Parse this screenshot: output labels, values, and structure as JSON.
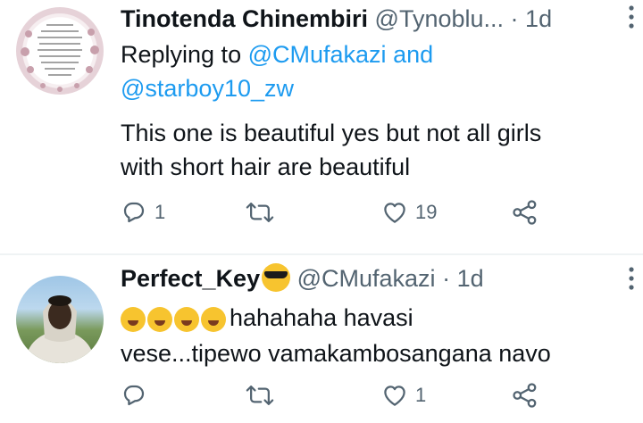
{
  "tweets": [
    {
      "name": "Tinotenda Chinembiri",
      "handle": "@Tynoblu...",
      "separator": "·",
      "time": "1d",
      "replying_prefix": "Replying to",
      "replying_user1": "@CMufakazi",
      "replying_and": "and",
      "replying_user2": "@starboy10_zw",
      "text_line1": "This one is beautiful yes but not all girls",
      "text_line2": "with short hair are beautiful",
      "reply_count": "1",
      "retweet_count": "",
      "like_count": "19"
    },
    {
      "name": "Perfect_Key",
      "handle": "@CMufakazi",
      "separator": "·",
      "time": "1d",
      "text_line1": "hahahaha havasi",
      "text_line2": "vese...tipewo vamakambosangana navo",
      "reply_count": "",
      "retweet_count": "",
      "like_count": "1"
    }
  ],
  "icons": [
    "reply-icon",
    "retweet-icon",
    "like-icon",
    "share-icon",
    "more-icon",
    "laughing-emoji-icon",
    "sunglasses-emoji-icon"
  ],
  "colors": {
    "text": "#0f1419",
    "secondary": "#536471",
    "link": "#1d9bf0",
    "divider": "#eff3f4"
  }
}
